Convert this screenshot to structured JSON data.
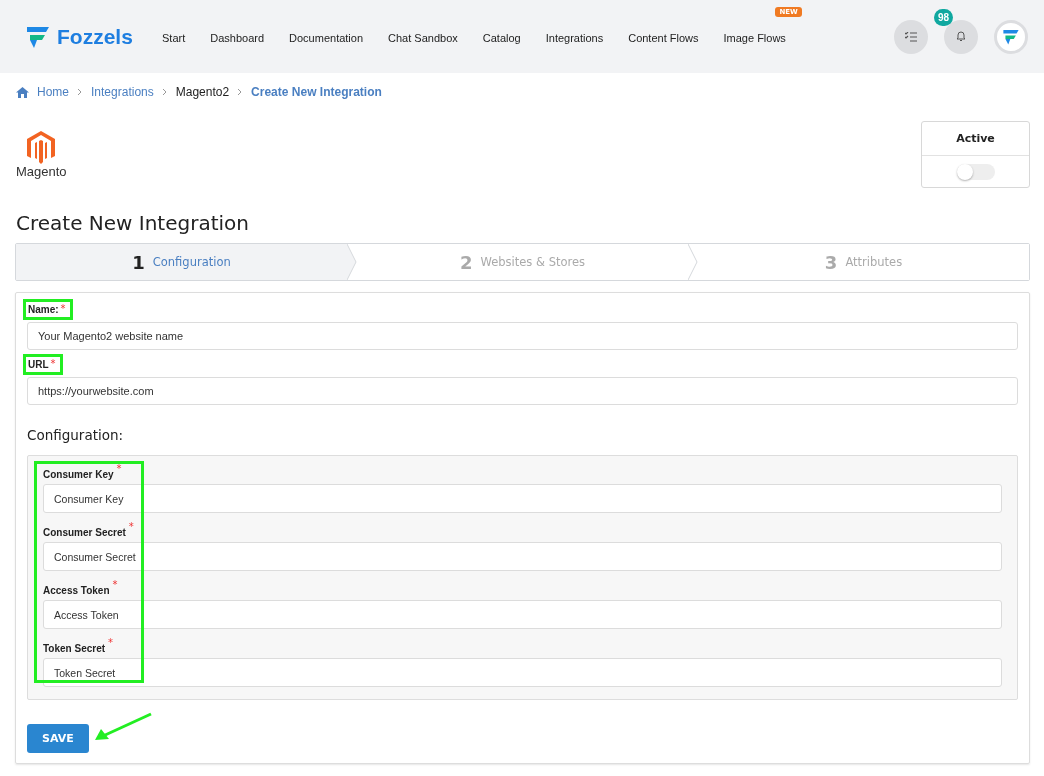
{
  "header": {
    "brand": "Fozzels",
    "nav": [
      {
        "label": "Start"
      },
      {
        "label": "Dashboard"
      },
      {
        "label": "Documentation"
      },
      {
        "label": "Chat Sandbox"
      },
      {
        "label": "Catalog"
      },
      {
        "label": "Integrations"
      },
      {
        "label": "Content Flows"
      },
      {
        "label": "Image Flows",
        "badge": "NEW"
      }
    ],
    "notification_count": "98"
  },
  "breadcrumb": [
    {
      "label": "Home",
      "kind": "link"
    },
    {
      "label": "Integrations",
      "kind": "link"
    },
    {
      "label": "Magento2",
      "kind": "plain"
    },
    {
      "label": "Create New Integration",
      "kind": "current"
    }
  ],
  "logo_text": "Magento",
  "active_panel": {
    "label": "Active",
    "on": false
  },
  "title": "Create New Integration",
  "steps": [
    {
      "number": "1",
      "label": "Configuration",
      "selected": true
    },
    {
      "number": "2",
      "label": "Websites & Stores",
      "selected": false
    },
    {
      "number": "3",
      "label": "Attributes",
      "selected": false
    }
  ],
  "fields": [
    {
      "label": "Name:",
      "required_mark": "*",
      "value": "Your Magento2 website name"
    },
    {
      "label": "URL",
      "required_mark": "*",
      "value": "https://yourwebsite.com"
    }
  ],
  "configuration": {
    "heading": "Configuration:",
    "fields": [
      {
        "label": "Consumer Key",
        "required_mark": "*",
        "value": "Consumer Key"
      },
      {
        "label": "Consumer Secret",
        "required_mark": "*",
        "value": "Consumer Secret"
      },
      {
        "label": "Access Token",
        "required_mark": "*",
        "value": "Access Token"
      },
      {
        "label": "Token Secret",
        "required_mark": "*",
        "value": "Token Secret"
      }
    ]
  },
  "save_button": "SAVE"
}
